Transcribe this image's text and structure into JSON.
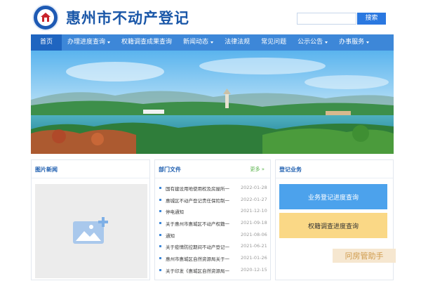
{
  "header": {
    "site_title": "惠州市不动产登记",
    "search_button": "搜索",
    "search_value": ""
  },
  "nav": {
    "items": [
      {
        "label": "首页",
        "has_dropdown": false
      },
      {
        "label": "办理进度查询",
        "has_dropdown": true
      },
      {
        "label": "权籍调查成果查询",
        "has_dropdown": false
      },
      {
        "label": "新闻动态",
        "has_dropdown": true
      },
      {
        "label": "法律法规",
        "has_dropdown": false
      },
      {
        "label": "常见问题",
        "has_dropdown": false
      },
      {
        "label": "公示公告",
        "has_dropdown": true
      },
      {
        "label": "办事服务",
        "has_dropdown": true
      }
    ]
  },
  "panels": {
    "pictures": {
      "title": "图片新闻"
    },
    "documents": {
      "title": "部门文件",
      "more": "更多 »",
      "items": [
        {
          "title": "国有建设用地使用权及房屋所一",
          "date": "2022-01-28"
        },
        {
          "title": "惠城区不动产登记责任保险制一",
          "date": "2022-01-27"
        },
        {
          "title": "停电通知",
          "date": "2021-12-10"
        },
        {
          "title": "关于惠州市惠城区不动产权籍一",
          "date": "2021-09-18"
        },
        {
          "title": "通知",
          "date": "2021-08-06"
        },
        {
          "title": "关于疫情防控期间不动产登记一",
          "date": "2021-06-21"
        },
        {
          "title": "惠州市惠城区自然资源局关于一",
          "date": "2021-01-26"
        },
        {
          "title": "关于印发《惠城区自然资源局一",
          "date": "2020-12-15"
        }
      ]
    },
    "registration": {
      "title": "登记业务",
      "buttons": [
        {
          "label": "业务登记进度查询"
        },
        {
          "label": "权籍调查进度查询"
        }
      ]
    }
  },
  "watermark": "冋房管助手",
  "colors": {
    "brand_blue": "#1a57a8",
    "nav_blue": "#3d87d8",
    "nav_active": "#1f65c0",
    "button_blue": "#4ca2ec",
    "button_yellow": "#fad886",
    "more_green": "#58b24a"
  }
}
